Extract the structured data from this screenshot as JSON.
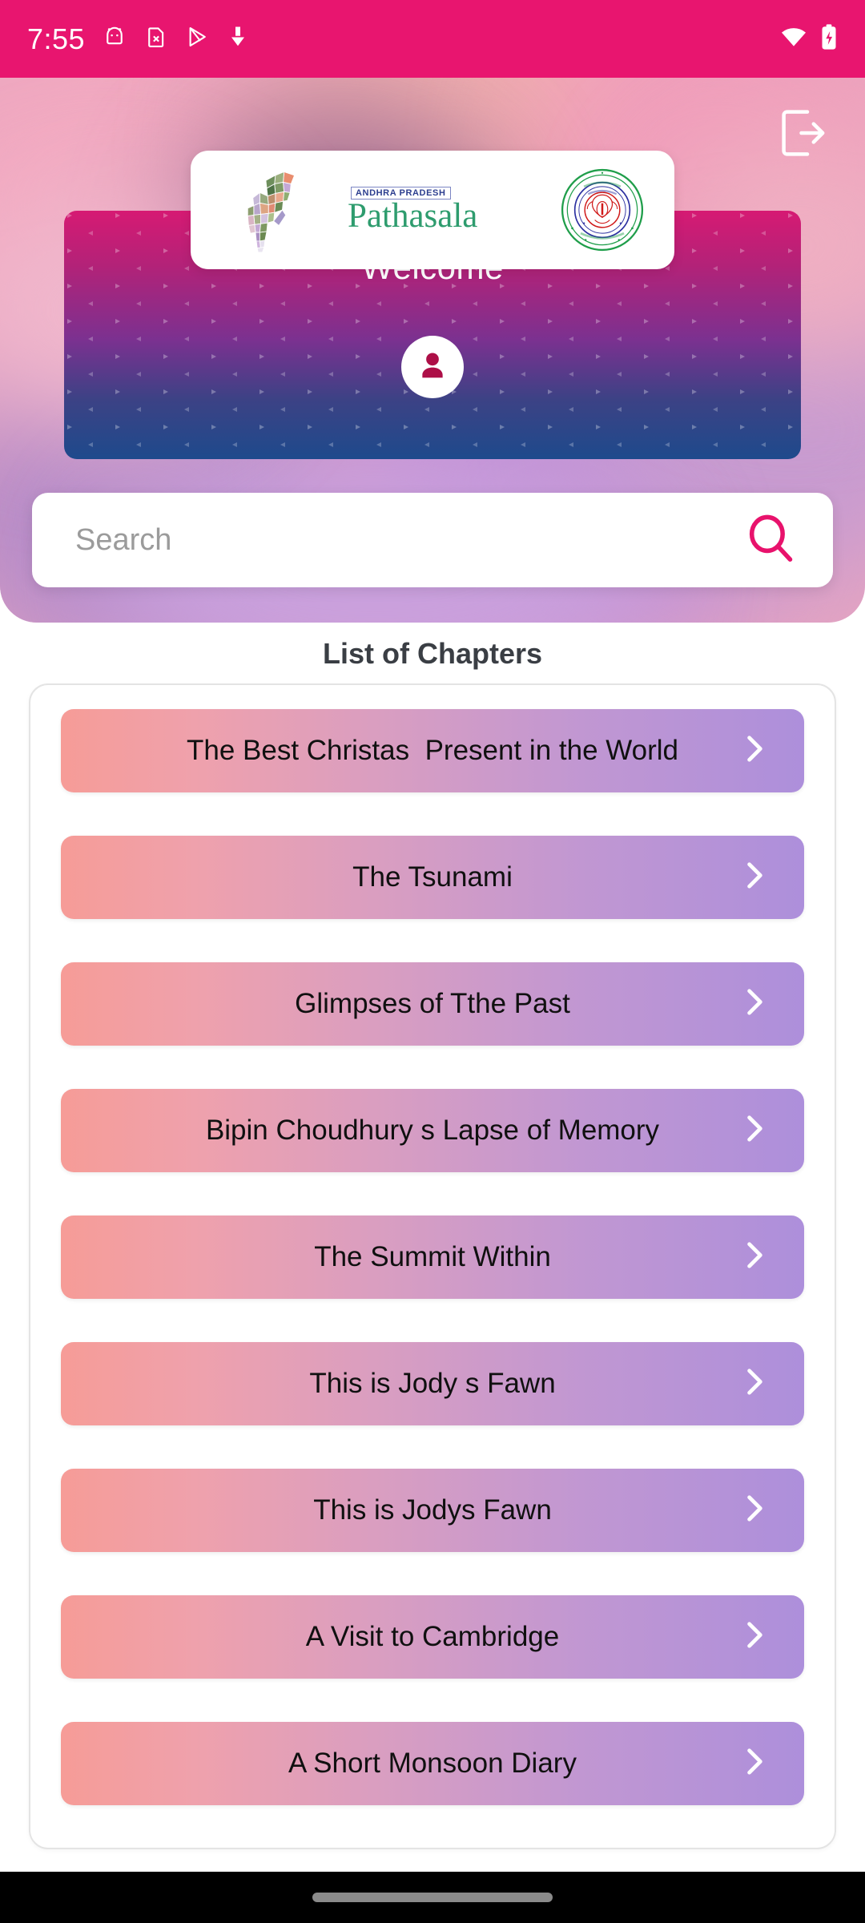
{
  "status_bar": {
    "time": "7:55",
    "left_icons": [
      "android-robot-icon",
      "file-x-icon",
      "play-store-icon",
      "download-arrow-icon"
    ],
    "right_icons": [
      "wifi-icon",
      "battery-charging-icon"
    ],
    "background_color": "#E8156F"
  },
  "header": {
    "logout_icon": "logout-icon",
    "logo_card": {
      "map_label": "andhra-pradesh-map-icon",
      "tagline": "ANDHRA PRADESH",
      "brand": "Pathasala",
      "seal_icon": "scert-seal-icon",
      "seal_text": "STATE COUNCIL OF EDUCATIONAL RESEARCH & TRAINING"
    },
    "banner": {
      "welcome_text": "Welcome",
      "avatar_icon": "user-avatar-icon",
      "gradient_from": "#D61A73",
      "gradient_to": "#1E4A8C"
    }
  },
  "search": {
    "placeholder": "Search",
    "value": "",
    "icon": "search-icon",
    "icon_color": "#E8156F"
  },
  "main": {
    "list_title": "List of Chapters",
    "chapters": [
      {
        "title": "The Best Christas  Present in the World",
        "chevron": "chevron-right-icon"
      },
      {
        "title": "The Tsunami",
        "chevron": "chevron-right-icon"
      },
      {
        "title": "Glimpses of Tthe Past",
        "chevron": "chevron-right-icon"
      },
      {
        "title": "Bipin Choudhury s Lapse of Memory",
        "chevron": "chevron-right-icon"
      },
      {
        "title": "The Summit Within",
        "chevron": "chevron-right-icon"
      },
      {
        "title": "This is Jody s Fawn",
        "chevron": "chevron-right-icon"
      },
      {
        "title": "This is Jodys Fawn",
        "chevron": "chevron-right-icon"
      },
      {
        "title": "A Visit to Cambridge",
        "chevron": "chevron-right-icon"
      },
      {
        "title": "A Short Monsoon Diary",
        "chevron": "chevron-right-icon"
      }
    ],
    "row_gradient_from": "#F69C97",
    "row_gradient_to": "#AD8FDB"
  },
  "nav_bar": {
    "handle": "gesture-home-handle"
  }
}
